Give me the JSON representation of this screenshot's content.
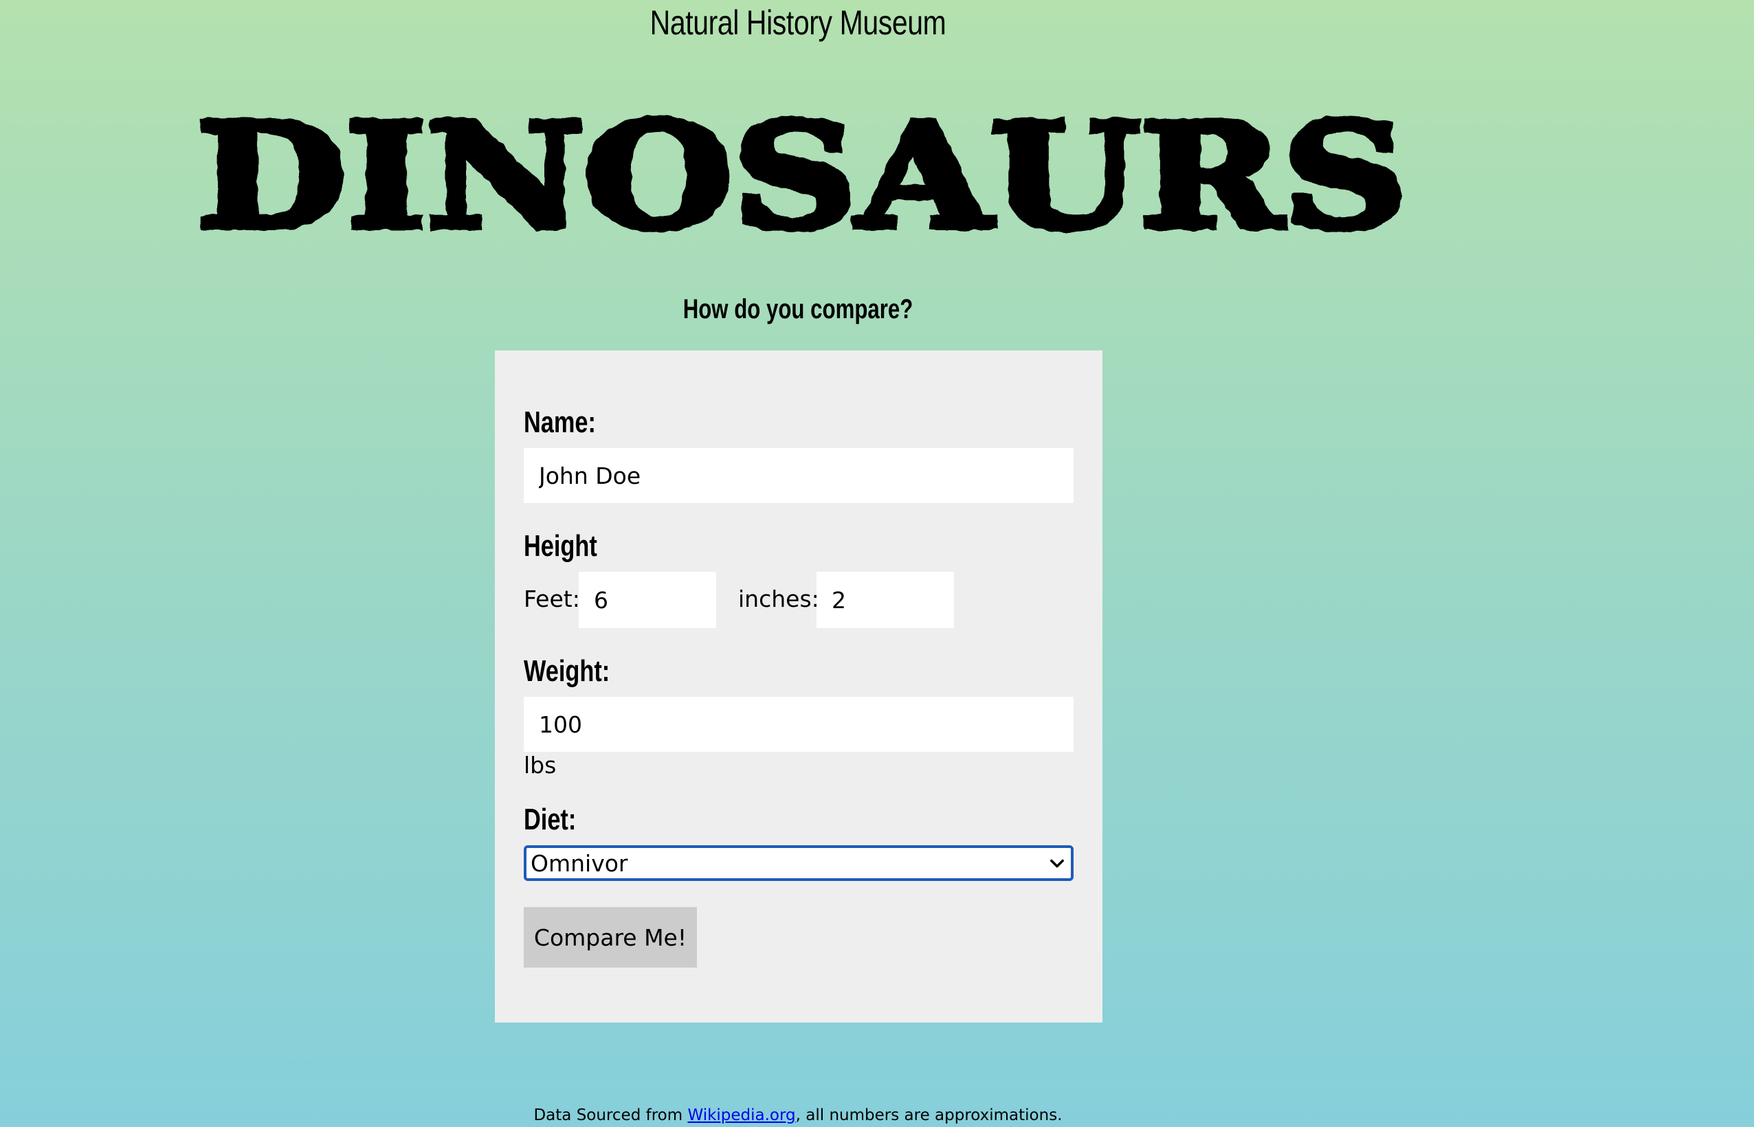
{
  "header": {
    "title": "Natural History Museum",
    "logo_text": "DINOSAURS",
    "subtitle": "How do you compare?"
  },
  "form": {
    "name_label": "Name:",
    "name_value": "John Doe",
    "height_label": "Height",
    "feet_label": "Feet:",
    "feet_value": "6",
    "inches_label": "inches:",
    "inches_value": "2",
    "weight_label": "Weight:",
    "weight_value": "100",
    "weight_unit": "lbs",
    "diet_label": "Diet:",
    "diet_value": "Omnivor",
    "submit_label": "Compare Me!"
  },
  "footer": {
    "prefix": "Data Sourced from ",
    "link_text": "Wikipedia.org",
    "suffix": ", all numbers are approximations."
  },
  "colors": {
    "gradient_top": "#b4e1ae",
    "gradient_bottom": "#86cfdb",
    "card_bg": "#eeeeee",
    "button_bg": "#cccccc",
    "select_focus": "#1f5bb8",
    "link": "#0000ee"
  }
}
